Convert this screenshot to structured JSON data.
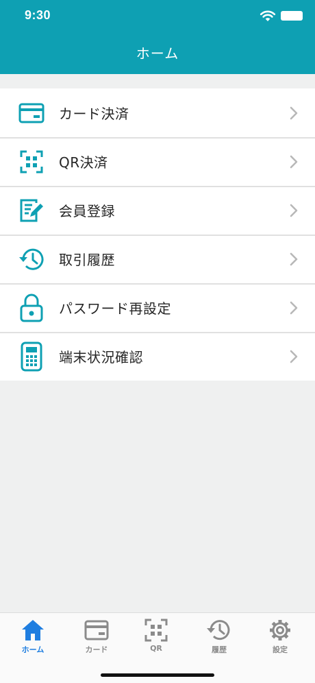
{
  "status_bar": {
    "time": "9:30"
  },
  "nav": {
    "title": "ホーム"
  },
  "colors": {
    "primary": "#0ea0b3",
    "tab_active": "#1f7ee0",
    "tab_inactive": "#8b8b8b"
  },
  "menu": {
    "items": [
      {
        "label": "カード決済",
        "icon": "credit-card-icon"
      },
      {
        "label": "QR決済",
        "icon": "qr-scan-icon"
      },
      {
        "label": "会員登録",
        "icon": "edit-document-icon"
      },
      {
        "label": "取引履歴",
        "icon": "history-icon"
      },
      {
        "label": "パスワード再設定",
        "icon": "lock-icon"
      },
      {
        "label": "端末状況確認",
        "icon": "terminal-device-icon"
      }
    ]
  },
  "tabbar": {
    "tabs": [
      {
        "label": "ホーム",
        "icon": "home-icon",
        "active": true
      },
      {
        "label": "カード",
        "icon": "credit-card-icon",
        "active": false
      },
      {
        "label": "QR",
        "icon": "qr-scan-icon",
        "active": false
      },
      {
        "label": "履歴",
        "icon": "history-icon",
        "active": false
      },
      {
        "label": "設定",
        "icon": "gear-icon",
        "active": false
      }
    ]
  }
}
